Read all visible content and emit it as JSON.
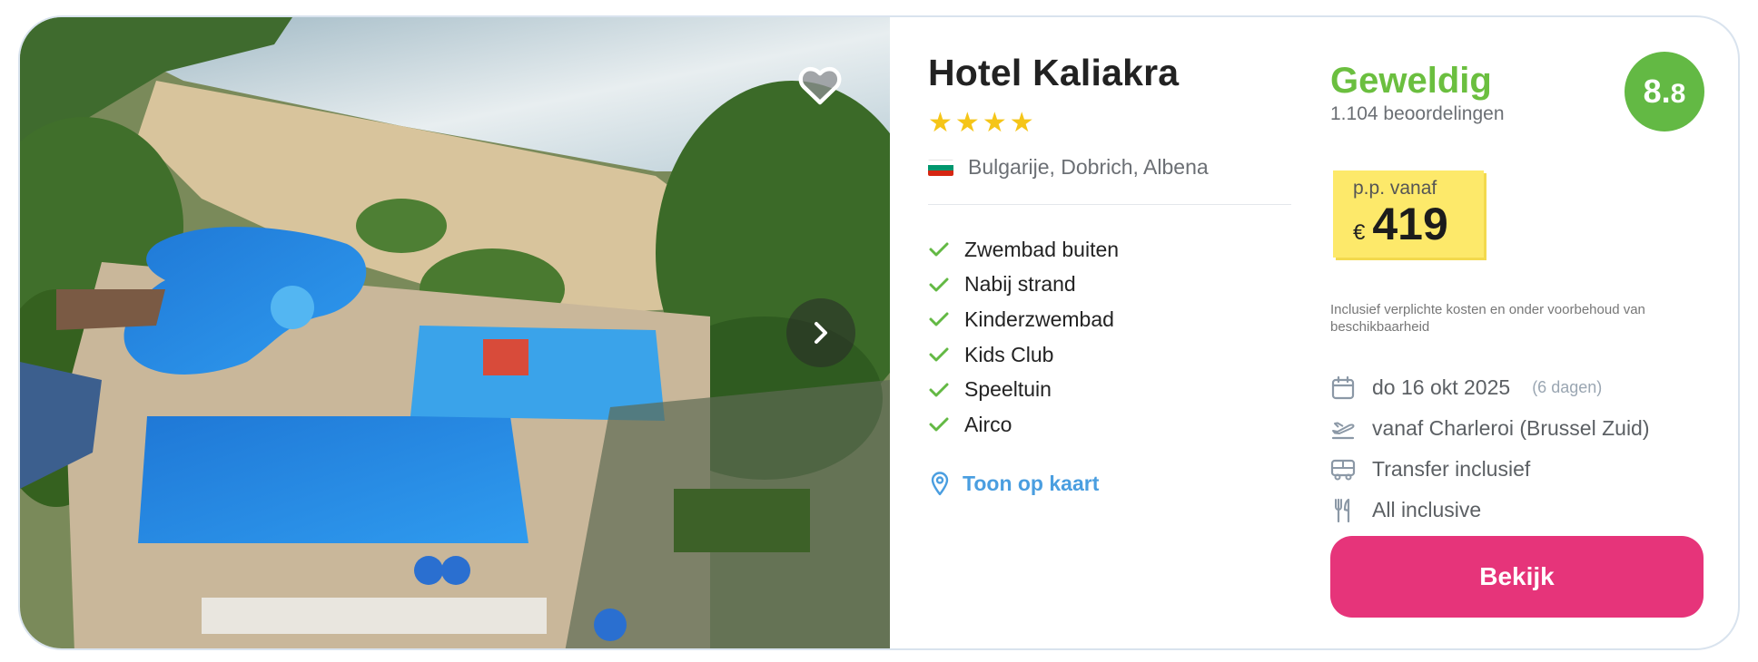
{
  "hotel": {
    "name": "Hotel Kaliakra",
    "stars": 4,
    "location": "Bulgarije, Dobrich, Albena",
    "flag_colors": [
      "#ffffff",
      "#00966e",
      "#d62612"
    ],
    "features": [
      "Zwembad buiten",
      "Nabij strand",
      "Kinderzwembad",
      "Kids Club",
      "Speeltuin",
      "Airco"
    ],
    "map_link": "Toon op kaart"
  },
  "rating": {
    "label": "Geweldig",
    "reviews": "1.104 beoordelingen",
    "score_main": "8.",
    "score_decimal": "8"
  },
  "price": {
    "label": "p.p. vanaf",
    "currency": "€",
    "amount": "419",
    "disclaimer": "Inclusief verplichte kosten en onder voorbehoud van beschikbaarheid"
  },
  "details": {
    "date": "do 16 okt 2025",
    "duration": "(6 dagen)",
    "departure": "vanaf Charleroi (Brussel Zuid)",
    "transfer": "Transfer inclusief",
    "board": "All inclusive"
  },
  "cta": {
    "label": "Bekijk"
  },
  "colors": {
    "accent_pink": "#e6347a",
    "rating_green": "#63b944",
    "link_blue": "#4a9ee0",
    "price_yellow": "#fde96a",
    "check_green": "#63b944"
  },
  "icons": {
    "favorite": "heart-icon",
    "next": "chevron-right-icon",
    "check": "check-icon",
    "map": "map-pin-icon",
    "date": "calendar-icon",
    "flight": "airplane-departure-icon",
    "transfer": "bus-icon",
    "board": "fork-knife-icon"
  }
}
